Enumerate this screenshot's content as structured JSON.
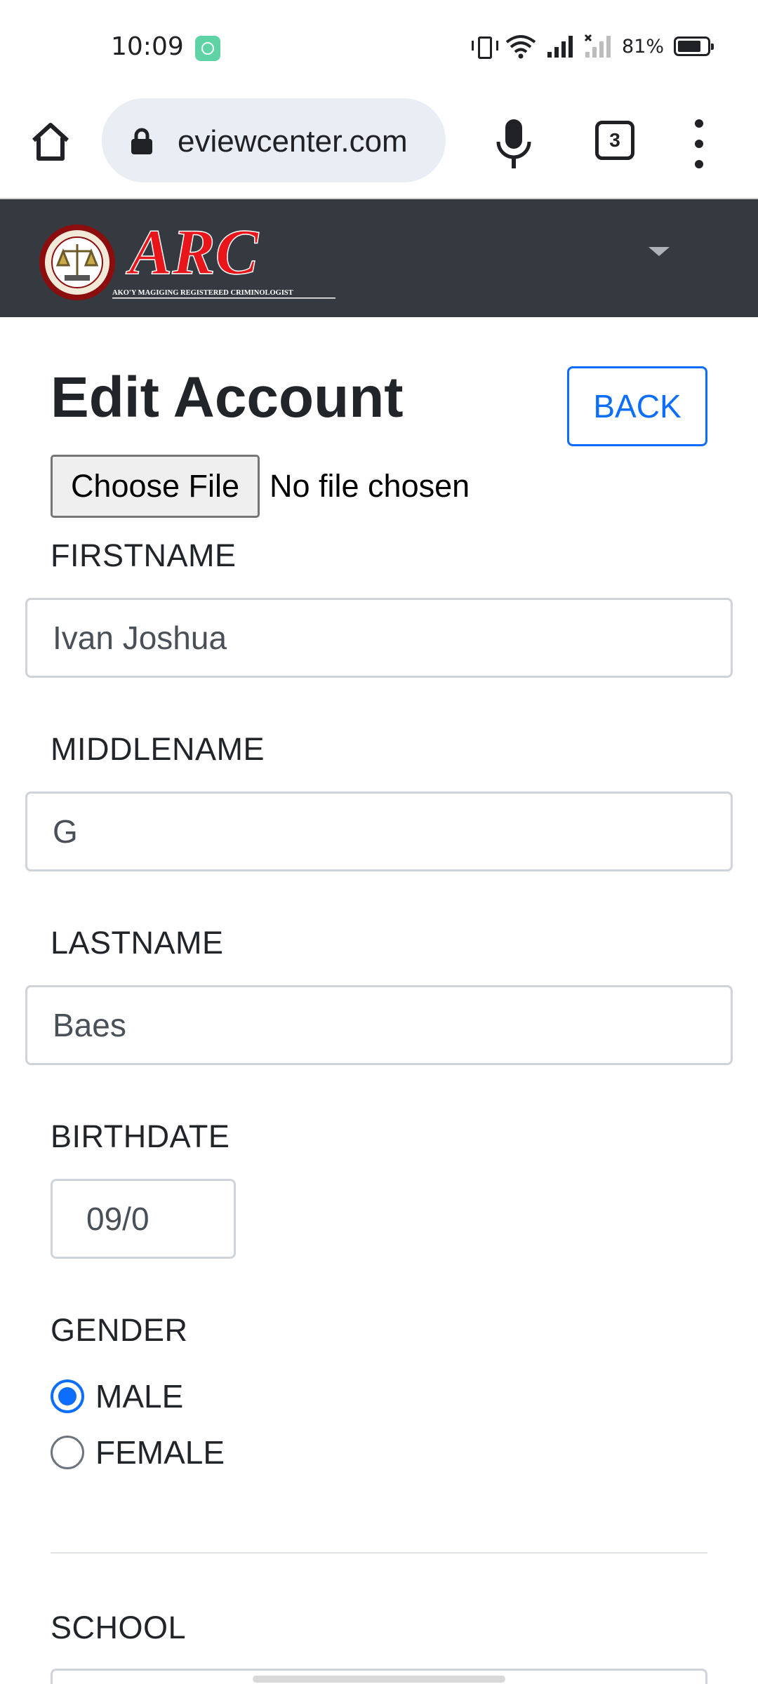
{
  "status_bar": {
    "time": "10:09",
    "battery_percent": "81%",
    "battery_level": 0.81,
    "icons": [
      "app-notification-icon",
      "vibrate-icon",
      "wifi-icon",
      "signal-icon",
      "no-sim-signal-icon",
      "battery-icon"
    ]
  },
  "browser": {
    "url": "eviewcenter.com",
    "tab_count": "3",
    "icons": [
      "home-icon",
      "lock-icon",
      "mic-icon",
      "tabs-icon",
      "more-vert-icon"
    ]
  },
  "site": {
    "logo_text": "ARC",
    "logo_tagline": "AKO'Y MAGIGING REGISTERED CRIMINOLOGIST",
    "colors": {
      "navbar": "#343a40",
      "primary": "#0d6efd",
      "logo_red": "#e8161b"
    }
  },
  "page": {
    "title": "Edit Account",
    "back_label": "BACK"
  },
  "file_input": {
    "button_label": "Choose File",
    "status": "No file chosen"
  },
  "form": {
    "firstname": {
      "label": "FIRSTNAME",
      "value": "Ivan Joshua"
    },
    "middlename": {
      "label": "MIDDLENAME",
      "value": "G"
    },
    "lastname": {
      "label": "LASTNAME",
      "value": "Baes"
    },
    "birthdate": {
      "label": "BIRTHDATE",
      "value": "09/0"
    },
    "gender": {
      "label": "GENDER",
      "options": [
        {
          "label": "MALE",
          "checked": true
        },
        {
          "label": "FEMALE",
          "checked": false
        }
      ]
    },
    "school": {
      "label": "SCHOOL"
    }
  }
}
